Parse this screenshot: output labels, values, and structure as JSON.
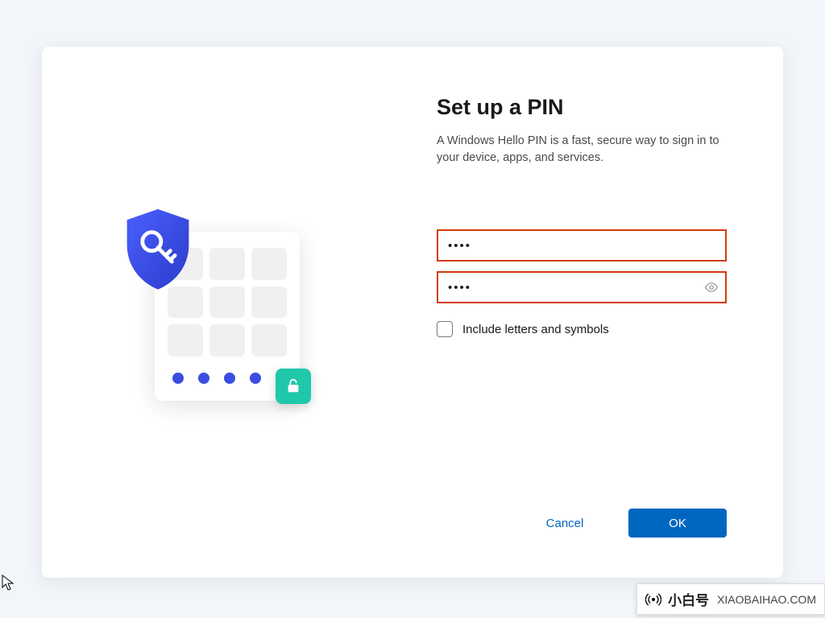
{
  "dialog": {
    "title": "Set up a PIN",
    "subtitle": "A Windows Hello PIN is a fast, secure way to sign in to your device, apps, and services.",
    "pin_value": "••••",
    "pin_confirm_value": "••••",
    "checkbox_label": "Include letters and symbols",
    "checkbox_checked": false,
    "buttons": {
      "cancel": "Cancel",
      "ok": "OK"
    }
  },
  "illustration": {
    "shield_icon": "shield-key",
    "unlock_icon": "unlock",
    "dot_count": 4,
    "key_count": 9
  },
  "watermark": {
    "brand_cn": "小白号",
    "brand_url": "XIAOBAIHAO.COM"
  },
  "colors": {
    "primary_button": "#0067c0",
    "input_border_error": "#d23c0a",
    "accent_dot": "#3b4de0",
    "unlock_badge": "#1fc8a9"
  }
}
